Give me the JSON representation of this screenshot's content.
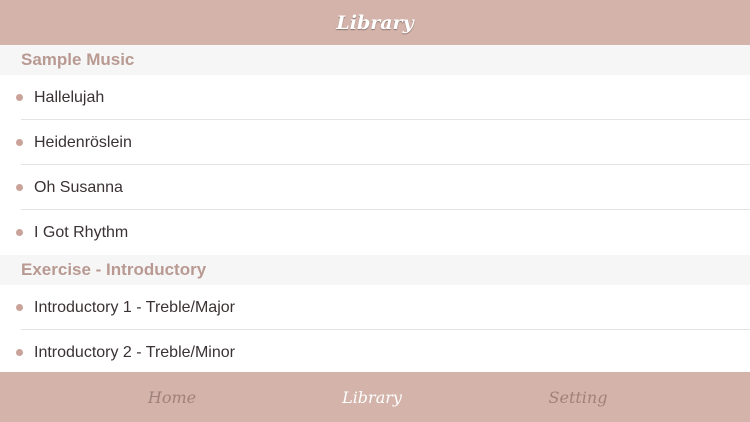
{
  "header": {
    "title": "Library"
  },
  "sections": [
    {
      "title": "Sample Music",
      "items": [
        {
          "label": "Hallelujah"
        },
        {
          "label": "Heidenröslein"
        },
        {
          "label": "Oh Susanna"
        },
        {
          "label": "I Got Rhythm"
        }
      ]
    },
    {
      "title": "Exercise - Introductory",
      "items": [
        {
          "label": "Introductory 1 - Treble/Major"
        },
        {
          "label": "Introductory 2 - Treble/Minor"
        }
      ]
    }
  ],
  "tabbar": {
    "tabs": [
      {
        "label": "Home",
        "active": false
      },
      {
        "label": "Library",
        "active": true
      },
      {
        "label": "Setting",
        "active": false
      }
    ]
  },
  "colors": {
    "bar_background": "#d3b3aa",
    "section_text": "#b89a92",
    "bullet": "#c9a39a",
    "active_tab": "#ffffff",
    "inactive_tab": "#a0827c"
  }
}
